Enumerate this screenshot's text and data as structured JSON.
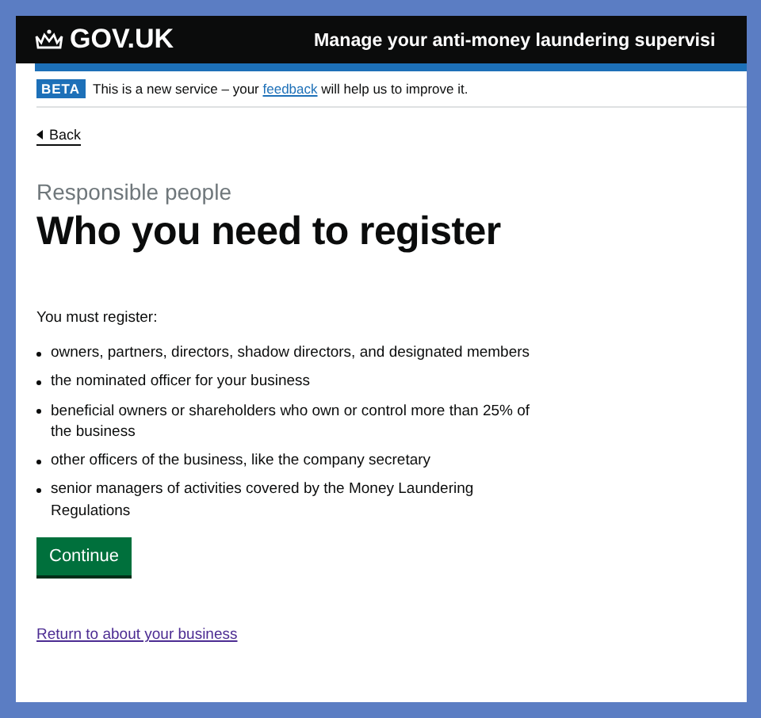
{
  "header": {
    "logo": "GOV.UK",
    "service_name": "Manage your anti-money laundering supervisi"
  },
  "phase_banner": {
    "tag": "BETA",
    "message_before": "This is a new service – your",
    "link": "feedback",
    "message_after": "will help us to improve it."
  },
  "back_link": "Back",
  "caption": "Responsible people",
  "heading": "Who you need to register",
  "intro": "You must register:",
  "items": [
    "owners, partners, directors, shadow directors, and designated members",
    "the nominated officer for your business",
    "beneficial owners or shareholders who own or control more than 25% of the business",
    "other officers of the business, like the company secretary",
    "senior managers of activities covered by the Money Laundering Regulations"
  ],
  "button": "Continue",
  "return_link": "Return to about your business"
}
